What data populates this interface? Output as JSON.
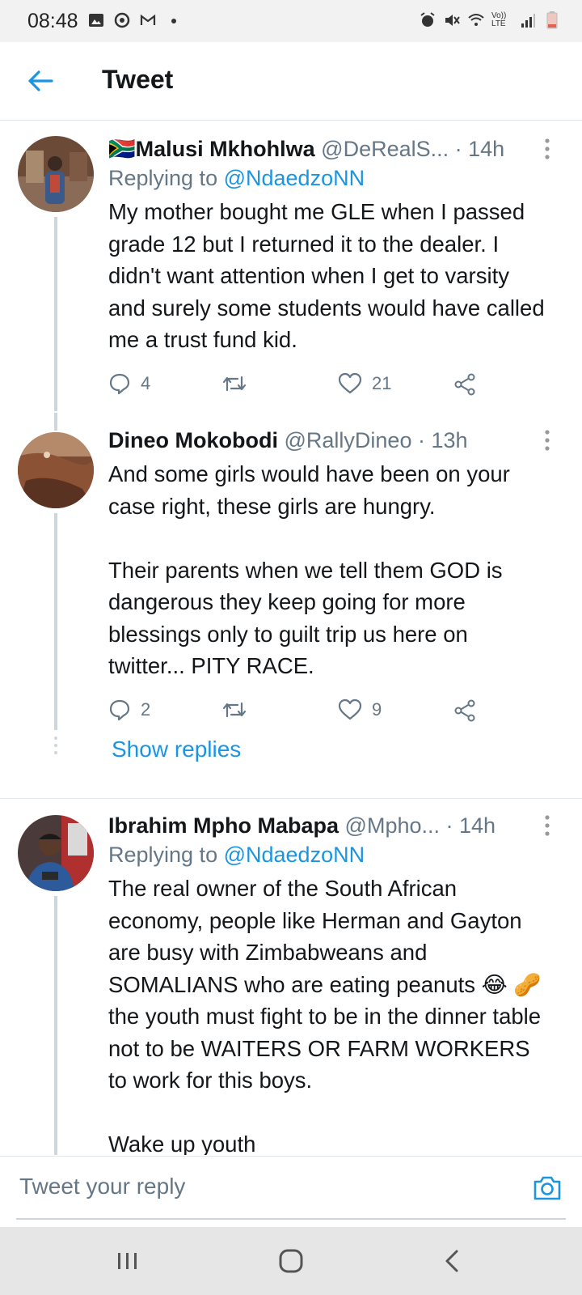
{
  "status_bar": {
    "time": "08:48",
    "left_icons": [
      "image-icon",
      "sync-icon",
      "gmail-icon",
      "dot-icon"
    ],
    "right_icons": [
      "alarm-icon",
      "mute-icon",
      "wifi-icon",
      "volte-icon",
      "signal-icon",
      "battery-icon"
    ],
    "volte_label": "Vo)) LTE"
  },
  "header": {
    "title": "Tweet"
  },
  "tweets": [
    {
      "flag": "🇿🇦",
      "name": "Malusi Mkhohlwa",
      "handle": "@DeRealS...",
      "time": " · 14h",
      "replying_prefix": "Replying to ",
      "replying_handle": "@NdaedzoNN",
      "text": "My mother bought me GLE when I passed grade 12 but I returned it to the dealer. I didn't want attention when I get to varsity and surely some students would have called me a trust fund kid.",
      "replies": "4",
      "retweets": "",
      "likes": "21"
    },
    {
      "name": "Dineo Mokobodi",
      "handle": "@RallyDineo",
      "time": " · 13h",
      "text": "And some girls would have been on your case right, these girls are hungry.\n\nTheir parents when we tell them GOD is dangerous they keep going for more blessings only to guilt trip us here on twitter... PITY RACE.",
      "replies": "2",
      "retweets": "",
      "likes": "9"
    },
    {
      "name": "Ibrahim Mpho Mabapa",
      "handle": "@Mpho...",
      "time": " · 14h",
      "replying_prefix": "Replying to ",
      "replying_handle": "@NdaedzoNN",
      "text": "The real owner of the South African economy, people like Herman and Gayton are busy with Zimbabweans and SOMALIANS who are eating peanuts 😂 🥜 the youth must fight to be in the dinner table not to be WAITERS OR FARM WORKERS to work for this boys.\n\nWake up youth"
    }
  ],
  "show_replies": "Show replies",
  "reply_bar": {
    "placeholder": "Tweet your reply"
  },
  "colors": {
    "accent": "#1b95e0",
    "secondary_text": "#657786",
    "primary_text": "#14171a"
  }
}
